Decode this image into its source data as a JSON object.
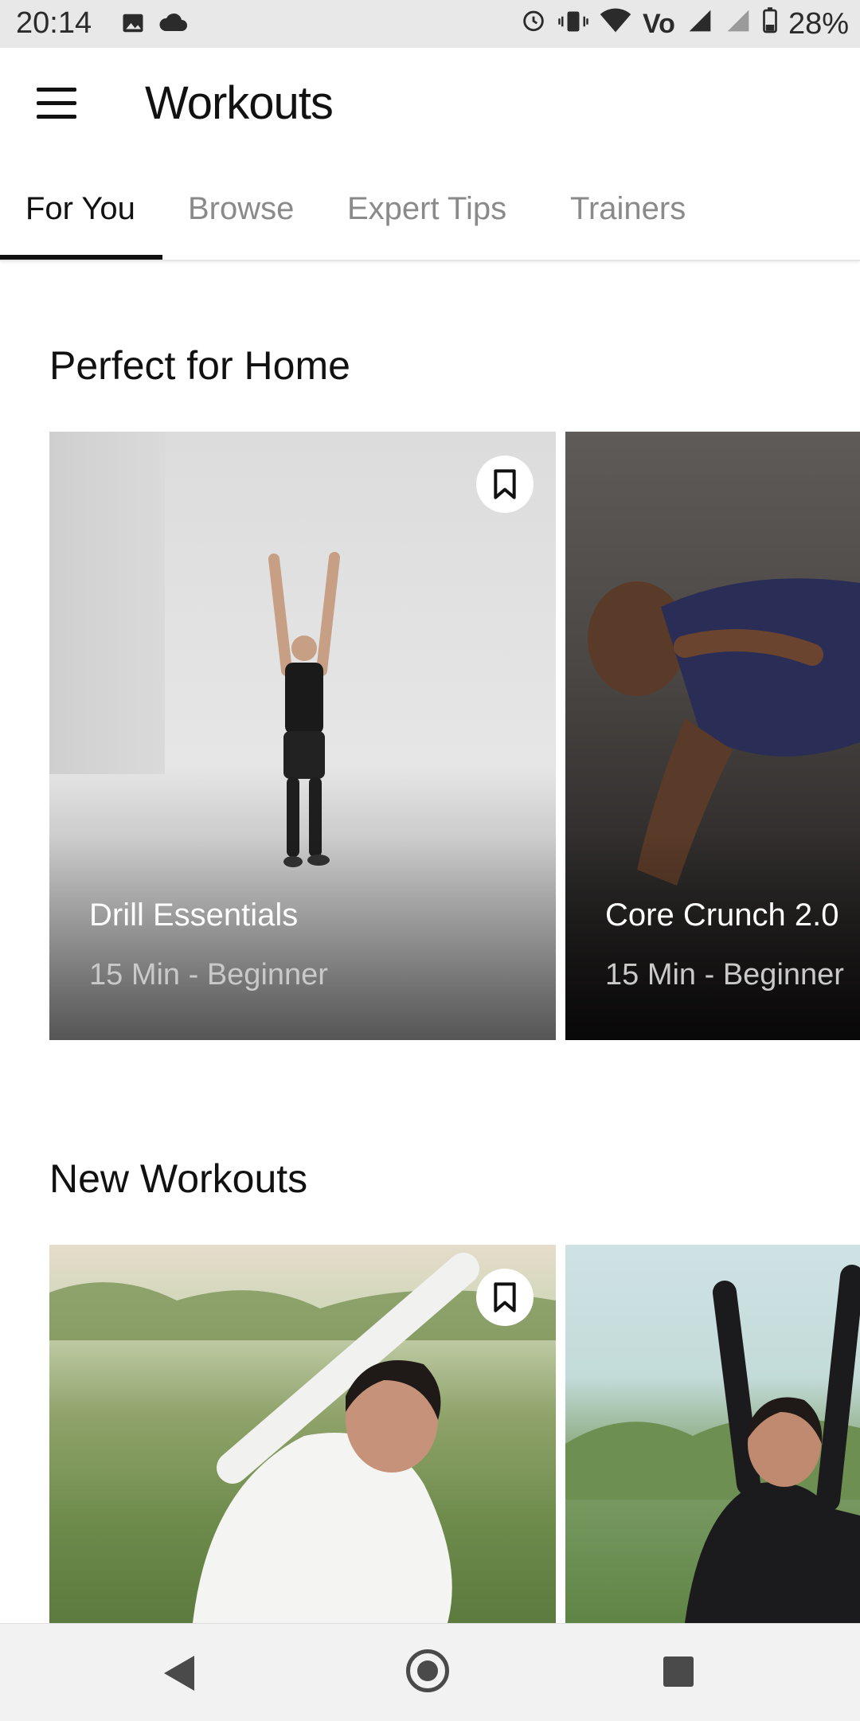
{
  "status_bar": {
    "time": "20:14",
    "battery": "28%",
    "left_icons": [
      "image-icon",
      "cloud-icon"
    ],
    "right_icons": [
      "alarm-icon",
      "vibrate-icon",
      "wifi-icon",
      "volte-icon",
      "signal-icon",
      "roaming-signal-icon",
      "battery-icon"
    ]
  },
  "app_bar": {
    "title": "Workouts",
    "menu_icon": "hamburger-menu-icon"
  },
  "tabs": [
    {
      "label": "For You",
      "active": true
    },
    {
      "label": "Browse",
      "active": false
    },
    {
      "label": "Expert Tips",
      "active": false
    },
    {
      "label": "Trainers",
      "active": false
    }
  ],
  "sections": [
    {
      "title": "Perfect for Home",
      "cards": [
        {
          "title": "Drill Essentials",
          "subtitle": "15 Min - Beginner",
          "bookmark_icon": "bookmark-icon"
        },
        {
          "title": "Core Crunch 2.0",
          "subtitle": "15 Min - Beginner"
        }
      ]
    },
    {
      "title": "New Workouts",
      "cards": [
        {
          "title": "",
          "subtitle": "",
          "bookmark_icon": "bookmark-icon"
        },
        {
          "title": "",
          "subtitle": ""
        }
      ]
    }
  ],
  "nav_bar": {
    "back_icon": "back-triangle-icon",
    "home_icon": "home-circle-icon",
    "recents_icon": "recents-square-icon"
  }
}
